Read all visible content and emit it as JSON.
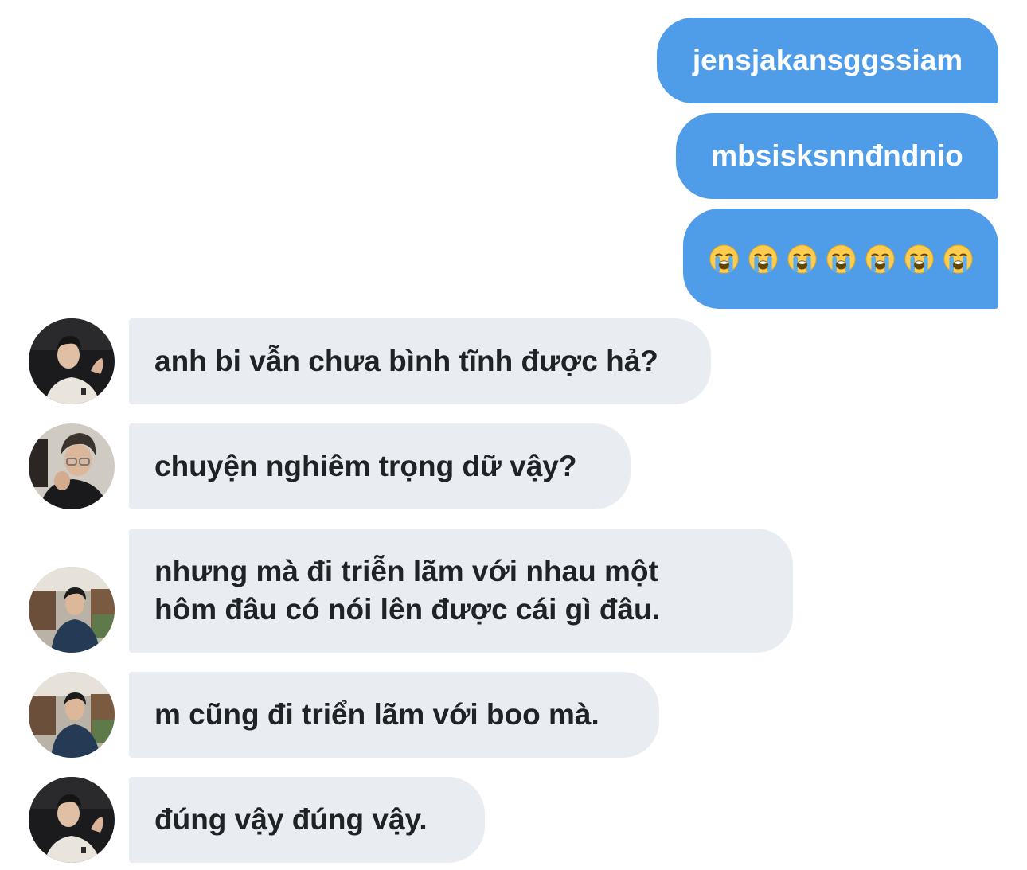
{
  "outgoing": [
    {
      "text": "jensjakansggssiam"
    },
    {
      "text": "mbsisksnnđndnio"
    },
    {
      "emoji": "loudly-crying-face",
      "count": 7
    }
  ],
  "incoming": [
    {
      "avatar": "avatar-man-waving",
      "lines": [
        "anh bi vẫn chưa bình tĩnh được hả?"
      ]
    },
    {
      "avatar": "avatar-man-glasses",
      "lines": [
        "chuyện nghiêm trọng dữ vậy?"
      ]
    },
    {
      "avatar": "avatar-man-street",
      "lines": [
        "nhưng mà đi triễn lãm với nhau một",
        "hôm đâu có nói lên được cái gì đâu."
      ]
    },
    {
      "avatar": "avatar-man-street",
      "lines": [
        "m cũng đi triển lãm với boo mà."
      ]
    },
    {
      "avatar": "avatar-man-waving",
      "lines": [
        "đúng vậy đúng vậy."
      ]
    }
  ],
  "colors": {
    "outgoing_bubble": "#4f9de9",
    "incoming_bubble": "#e9edf1",
    "incoming_text": "#202326"
  }
}
